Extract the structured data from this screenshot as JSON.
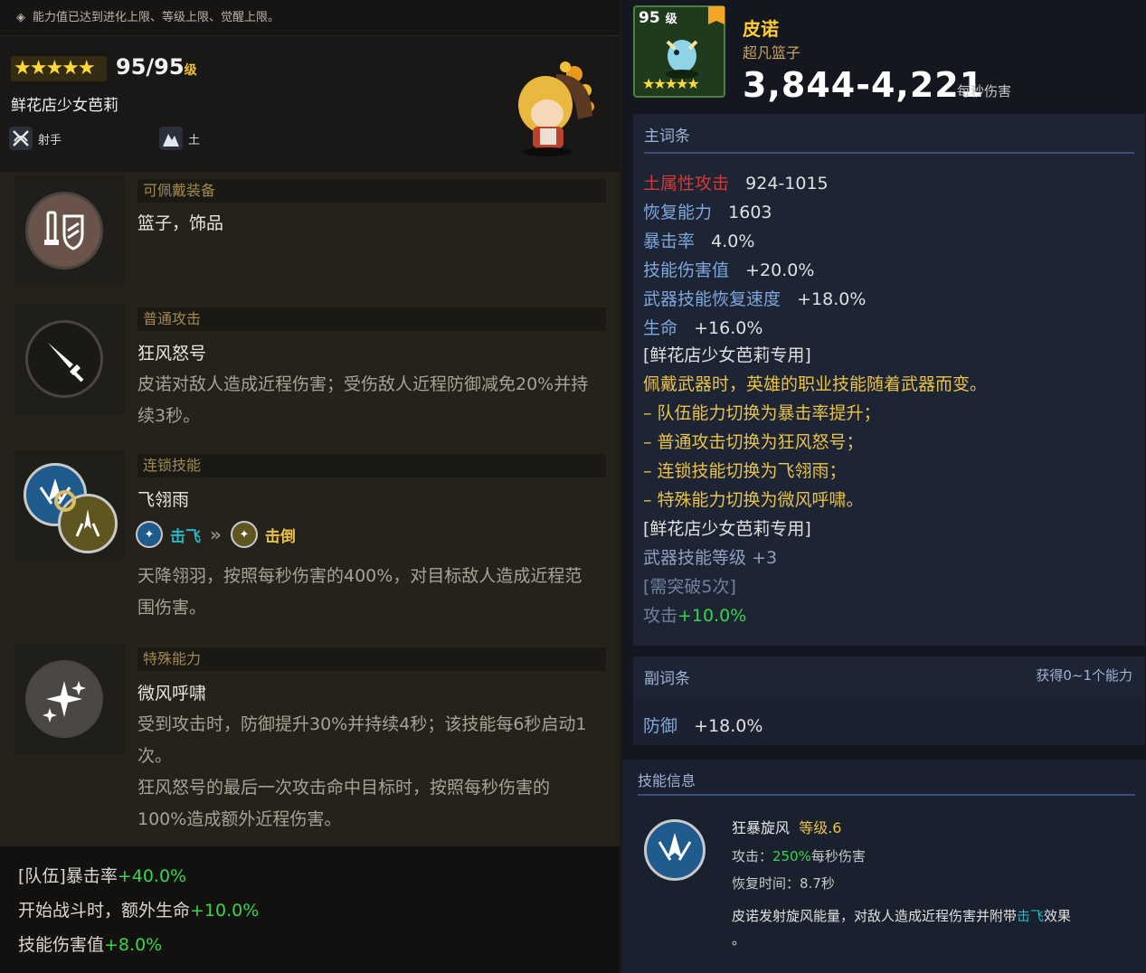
{
  "notice": "能力值已达到进化上限、等级上限、觉醒上限。",
  "hero": {
    "stars": "★★★★★",
    "level": "95/95",
    "level_unit": "级",
    "name": "鲜花店少女芭莉",
    "class_label": "射手",
    "element_label": "土"
  },
  "sections": {
    "equip": {
      "header": "可佩戴装备",
      "title": "篮子，饰品"
    },
    "normal": {
      "header": "普通攻击",
      "title": "狂风怒号",
      "desc": "皮诺对敌人造成近程伤害；受伤敌人近程防御减免20%并持续3秒。"
    },
    "chain": {
      "header": "连锁技能",
      "title": "飞翎雨",
      "from": "击飞",
      "to": "击倒",
      "desc": "天降翎羽，按照每秒伤害的400%，对目标敌人造成近程范围伤害。"
    },
    "special": {
      "header": "特殊能力",
      "title": "微风呼啸",
      "desc1": "受到攻击时，防御提升30%并持续4秒；该技能每6秒启动1次。",
      "desc2": "狂风怒号的最后一次攻击命中目标时，按照每秒伤害的100%造成额外近程伤害。"
    }
  },
  "party": [
    {
      "label": "[队伍]暴击率",
      "value": "+40.0%"
    },
    {
      "label": "开始战斗时，额外生命",
      "value": "+10.0%"
    },
    {
      "label": "技能伤害值",
      "value": "+8.0%"
    }
  ],
  "weapon": {
    "level": "95",
    "level_unit": "级",
    "stars": "★★★★★",
    "name": "皮诺",
    "type": "超凡篮子",
    "dps": "3,844-4,221",
    "dps_unit": "每秒伤害"
  },
  "main_stats": {
    "header": "主词条",
    "rows": [
      {
        "k": "土属性攻击",
        "v": "924-1015"
      },
      {
        "k": "恢复能力",
        "v": "1603"
      },
      {
        "k": "暴击率",
        "v": "4.0%"
      },
      {
        "k": "技能伤害值",
        "v": "+20.0%"
      },
      {
        "k": "武器技能恢复速度",
        "v": "+18.0%"
      },
      {
        "k": "生命",
        "v": "+16.0%"
      }
    ],
    "exclusive1": "[鲜花店少女芭莉专用]",
    "exclusive_desc": "佩戴武器时，英雄的职业技能随着武器而变。",
    "bullets": [
      "–  队伍能力切换为暴击率提升；",
      "–  普通攻击切换为狂风怒号；",
      "–  连锁技能切换为飞翎雨；",
      "–  特殊能力切换为微风呼啸。"
    ],
    "exclusive2": "[鲜花店少女芭莉专用]",
    "wskill_label": "武器技能等级",
    "wskill_val": "+3",
    "need": "[需突破5次]",
    "atk_label": "攻击",
    "atk_val": "+10.0%"
  },
  "sub_stats": {
    "header": "副词条",
    "hint": "获得0~1个能力",
    "k": "防御",
    "v": "+18.0%"
  },
  "skill": {
    "header": "技能信息",
    "name": "狂暴旋风",
    "level": "等级.6",
    "atk_label": "攻击：",
    "atk_val": "250%",
    "atk_unit": "每秒伤害",
    "cd_label": "恢复时间：",
    "cd_val": "8.7秒",
    "desc_a": "皮诺发射旋风能量，对敌人造成近程伤害并附带",
    "desc_b": "击飞",
    "desc_c": "效果",
    "desc_d": "。"
  }
}
